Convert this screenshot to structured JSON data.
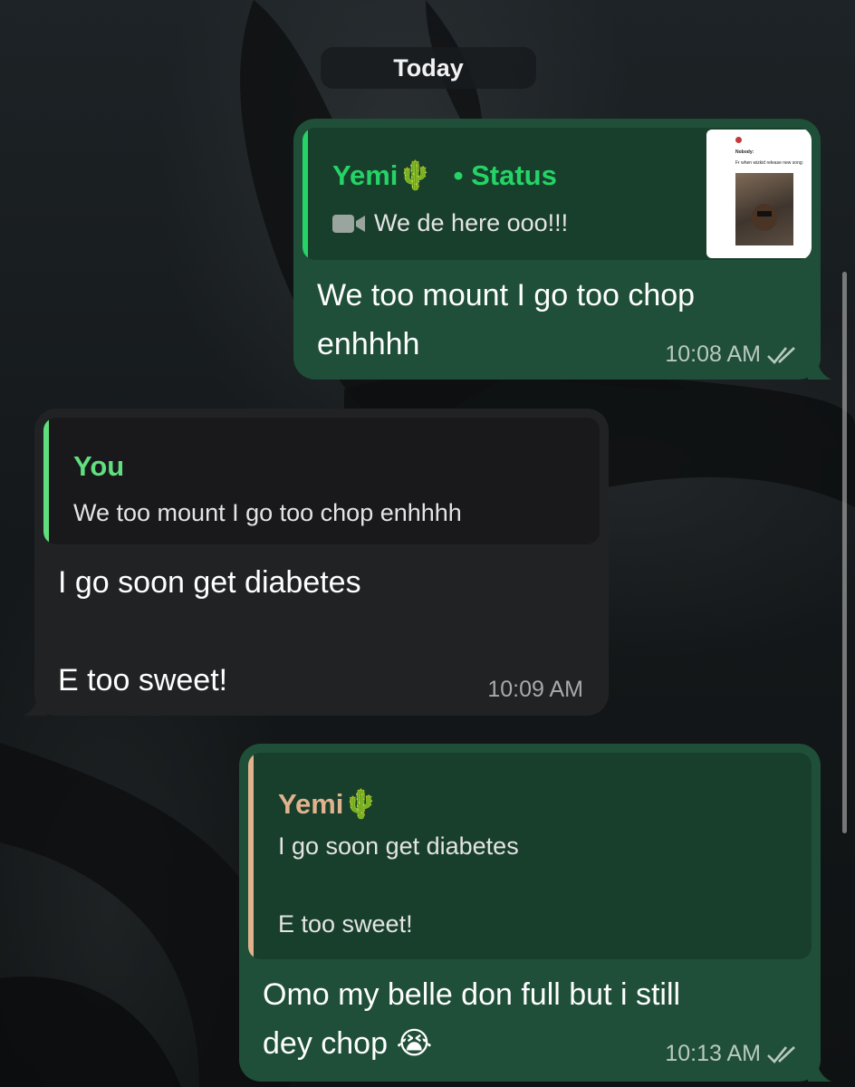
{
  "date_separator": "Today",
  "messages": [
    {
      "direction": "outgoing",
      "reply": {
        "name": "Yemi",
        "emoji": "🌵",
        "status_label": "• Status",
        "media_icon": "video-camera-icon",
        "text": "We de here ooo!!!",
        "thumbnail": {
          "header": "Nobody:",
          "line": "Fr when wizkid release new song:"
        }
      },
      "text_lines": [
        "We too mount I go too chop",
        "enhhhh"
      ],
      "time": "10:08 AM",
      "status_icon": "double-check-icon"
    },
    {
      "direction": "incoming",
      "reply": {
        "name": "You",
        "text": "We too mount I go too chop enhhhh"
      },
      "text_lines": [
        "I go soon get diabetes",
        "",
        "E too sweet!"
      ],
      "time": "10:09 AM"
    },
    {
      "direction": "outgoing",
      "reply": {
        "name": "Yemi",
        "emoji": "🌵",
        "text_lines": [
          "I go soon get diabetes",
          "",
          "E too sweet!"
        ]
      },
      "text_lines": [
        "Omo my belle don full but i still",
        "dey chop 😭"
      ],
      "time": "10:13 AM",
      "status_icon": "double-check-icon"
    }
  ],
  "colors": {
    "outgoing_bubble": "#1f4f38",
    "incoming_bubble": "#212224",
    "status_name_green": "#25d366",
    "you_name_green": "#5fdf7e",
    "yemi_reply_tan": "#e0b28e",
    "read_tick": "#b9c9bf"
  }
}
